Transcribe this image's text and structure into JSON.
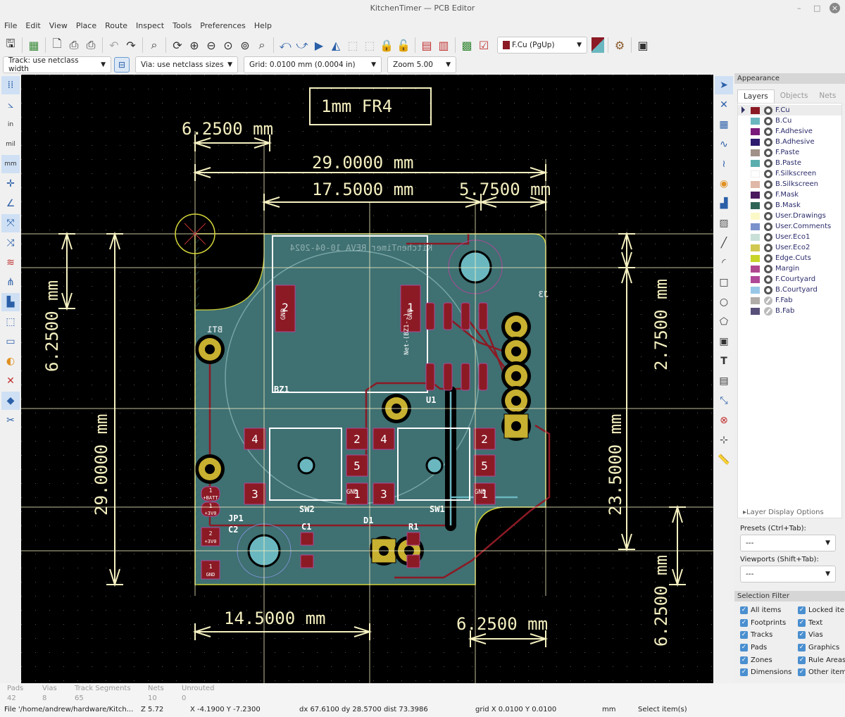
{
  "window": {
    "title": "KitchenTimer — PCB Editor"
  },
  "menu": [
    "File",
    "Edit",
    "View",
    "Place",
    "Route",
    "Inspect",
    "Tools",
    "Preferences",
    "Help"
  ],
  "toolbar": {
    "layer_select": "F.Cu (PgUp)",
    "layer_color": "#8b1a24"
  },
  "toolbar2": {
    "track": "Track: use netclass width",
    "via": "Via: use netclass sizes",
    "grid": "Grid: 0.0100 mm (0.0004 in)",
    "zoom": "Zoom 5.00"
  },
  "appearance": {
    "title": "Appearance",
    "tabs": [
      "Layers",
      "Objects",
      "Nets"
    ],
    "layers": [
      {
        "name": "F.Cu",
        "color": "#8b1a24",
        "visible": true
      },
      {
        "name": "B.Cu",
        "color": "#6bb7c0",
        "visible": true
      },
      {
        "name": "F.Adhesive",
        "color": "#7a1a7a",
        "visible": true
      },
      {
        "name": "B.Adhesive",
        "color": "#2e1a6e",
        "visible": true
      },
      {
        "name": "F.Paste",
        "color": "#a09088",
        "visible": true
      },
      {
        "name": "B.Paste",
        "color": "#5aaeae",
        "visible": true
      },
      {
        "name": "F.Silkscreen",
        "color": "#ffffff",
        "visible": true
      },
      {
        "name": "B.Silkscreen",
        "color": "#e0b8a8",
        "visible": true
      },
      {
        "name": "F.Mask",
        "color": "#4a1a5e",
        "visible": true
      },
      {
        "name": "B.Mask",
        "color": "#2e6458",
        "visible": true
      },
      {
        "name": "User.Drawings",
        "color": "#fbf8c8",
        "visible": true
      },
      {
        "name": "User.Comments",
        "color": "#7a92cc",
        "visible": true
      },
      {
        "name": "User.Eco1",
        "color": "#c8e0d8",
        "visible": true
      },
      {
        "name": "User.Eco2",
        "color": "#d0c850",
        "visible": true
      },
      {
        "name": "Edge.Cuts",
        "color": "#c8d428",
        "visible": true
      },
      {
        "name": "Margin",
        "color": "#b04890",
        "visible": true
      },
      {
        "name": "F.Courtyard",
        "color": "#b04898",
        "visible": true
      },
      {
        "name": "B.Courtyard",
        "color": "#98c8e8",
        "visible": true
      },
      {
        "name": "F.Fab",
        "color": "#b0aca8",
        "visible": false
      },
      {
        "name": "B.Fab",
        "color": "#585078",
        "visible": false
      }
    ],
    "layer_display_options": "Layer Display Options",
    "presets_label": "Presets (Ctrl+Tab):",
    "presets_value": "---",
    "viewports_label": "Viewports (Shift+Tab):",
    "viewports_value": "---"
  },
  "selection_filter": {
    "title": "Selection Filter",
    "items": [
      {
        "label": "All items",
        "checked": true
      },
      {
        "label": "Locked ite",
        "checked": true
      },
      {
        "label": "Footprints",
        "checked": true
      },
      {
        "label": "Text",
        "checked": true
      },
      {
        "label": "Tracks",
        "checked": true
      },
      {
        "label": "Vias",
        "checked": true
      },
      {
        "label": "Pads",
        "checked": true
      },
      {
        "label": "Graphics",
        "checked": true
      },
      {
        "label": "Zones",
        "checked": true
      },
      {
        "label": "Rule Areas",
        "checked": true
      },
      {
        "label": "Dimensions",
        "checked": true
      },
      {
        "label": "Other item",
        "checked": true
      }
    ]
  },
  "stats": [
    {
      "label": "Pads",
      "value": "42"
    },
    {
      "label": "Vias",
      "value": "8"
    },
    {
      "label": "Track Segments",
      "value": "65"
    },
    {
      "label": "Nets",
      "value": "10"
    },
    {
      "label": "Unrouted",
      "value": "0"
    }
  ],
  "statusbar": {
    "file": "File '/home/andrew/hardware/Kitch...",
    "zoom": "Z 5.72",
    "xy": "X -4.1900  Y -7.2300",
    "delta": "dx 67.6100  dy 28.5700  dist 73.3986",
    "grid": "grid X 0.0100  Y 0.0100",
    "units": "mm",
    "mode": "Select item(s)"
  },
  "pcb": {
    "note": "1mm FR4",
    "dims": [
      "6.2500 mm",
      "29.0000 mm",
      "17.5000 mm",
      "5.7500 mm",
      "6.2500 mm",
      "29.0000 mm",
      "2.7500 mm",
      "23.5000 mm",
      "6.2500 mm",
      "14.5000 mm",
      "6.2500 mm"
    ],
    "silk_text": "KitchenTimer REVA 10-04-2024",
    "refs": [
      "BT1",
      "BZ1",
      "SW2",
      "SW1",
      "JP1",
      "C2",
      "C1",
      "D1",
      "R1",
      "U1",
      "J3"
    ],
    "pads": [
      "4",
      "2",
      "4",
      "2",
      "5",
      "5",
      "3",
      "1",
      "3",
      "1",
      "2",
      "1",
      "1",
      "1",
      "2",
      "1",
      "2",
      "2",
      "5",
      "4",
      "3",
      "2",
      "1"
    ],
    "pad_nets": [
      "GND",
      "GND",
      "GND",
      "Net-(BZ1--)",
      "GND",
      "+BATT",
      "+3V0",
      "+3V0",
      "GND"
    ]
  }
}
